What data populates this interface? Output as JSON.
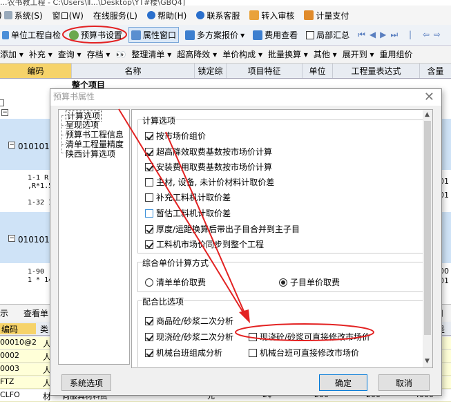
{
  "window": {
    "title": "...农书教工程 - C:\\Users\\Ⅱ...\\Desktop\\YT#楼\\GBQ4]"
  },
  "menubar": [
    "系统(S)",
    "窗口(W)",
    "在线服务(L)",
    "帮助(H)",
    "联系客服",
    "转入审核",
    "计量支付"
  ],
  "toolbar1": {
    "items": [
      "单位工程自检",
      "预算书设置",
      "属性窗口",
      "多方案报价",
      "费用查看",
      "局部汇总"
    ]
  },
  "toolbar2": {
    "items": [
      "添加",
      "补充",
      "查询",
      "存档",
      "整理清单",
      "超高降效",
      "单价构成",
      "批量换算",
      "其他",
      "展开到",
      "重用组价"
    ]
  },
  "grid": {
    "headers": [
      "编码",
      "名称",
      "锁定综",
      "项目特征",
      "单位",
      "工程量表达式",
      "含量"
    ],
    "partial_title": "整个项目",
    "codes": [
      "0101010",
      "0101010"
    ],
    "sub_rows": [
      "1-1  R",
      ",R*1.5",
      "1-32  I",
      "1-90",
      "1 * 14"
    ],
    "right_values": [
      "01",
      "01",
      "00",
      "01"
    ]
  },
  "lower": {
    "tabs": [
      "示",
      "查看单"
    ],
    "right_label": "用户",
    "header": [
      "编码",
      "类"
    ],
    "right_header": "是否",
    "rows": [
      "00010@2",
      "0002",
      "0003",
      "FTZ",
      "CLFO"
    ],
    "last_row_name": "向服具材料费",
    "last_row_values": [
      "元",
      "2¢",
      "200",
      "200",
      "4000"
    ]
  },
  "dialog": {
    "title": "预算书属性",
    "tree": [
      "计算选项",
      "呈现选项",
      "预算书工程信息",
      "清单工程量精度",
      "陕西计算选项"
    ],
    "group1": {
      "title": "计算选项",
      "options": [
        {
          "label": "按市场价组价",
          "checked": true
        },
        {
          "label": "超高降效取费基数按市场价计算",
          "checked": true
        },
        {
          "label": "安装费用取费基数按市场价计算",
          "checked": true
        },
        {
          "label": "主材, 设备, 未计价材料计取价差",
          "checked": false
        },
        {
          "label": "补充工料机计取价差",
          "checked": false
        },
        {
          "label": "暂估工料机计取价差",
          "checked": false
        },
        {
          "label": "厚度/运距换算后带出子目合并到主子目",
          "checked": true
        },
        {
          "label": "工料机市场价同步到整个工程",
          "checked": true
        }
      ]
    },
    "group2": {
      "title": "综合单价计算方式",
      "options": [
        {
          "label": "清单单价取费",
          "selected": false
        },
        {
          "label": "子目单价取费",
          "selected": true
        }
      ]
    },
    "group3": {
      "title": "配合比选项",
      "options": [
        {
          "label": "商品砼/砂浆二次分析",
          "checked": true
        },
        {
          "label": "现浇砼/砂浆二次分析",
          "checked": true
        },
        {
          "label": "现浇砼/砂浆可直接修改市场价",
          "checked": false
        },
        {
          "label": "机械台班组成分析",
          "checked": true
        },
        {
          "label": "机械台班可直接修改市场价",
          "checked": false
        }
      ]
    },
    "buttons": {
      "system": "系统选项",
      "ok": "确定",
      "cancel": "取消"
    }
  },
  "colors": {
    "annotation": "#e32222",
    "accent": "#0078d7",
    "grid_band": "#cfe3f7",
    "lower_rows": "#ffffd8"
  }
}
